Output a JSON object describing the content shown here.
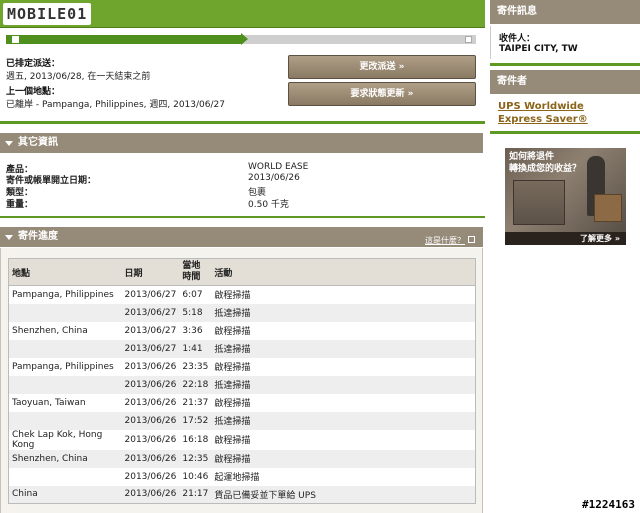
{
  "brand": {
    "logo_text": "MOBILE01"
  },
  "progress": {
    "fraction": 0.5
  },
  "shipment": {
    "scheduled_label": "已排定派送：",
    "scheduled_value": "週五, 2013/06/28, 在一天結束之前",
    "last_location_label": "上一個地點：",
    "last_location_value": "已離岸 - Pampanga, Philippines, 週四, 2013/06/27"
  },
  "buttons": {
    "change_delivery": "更改派送 »",
    "request_update": "要求狀態更新 »"
  },
  "other_info": {
    "title": "其它資訊",
    "rows": [
      {
        "key": "產品：",
        "value": "WORLD EASE"
      },
      {
        "key": "寄件或帳單開立日期：",
        "value": "2013/06/26"
      },
      {
        "key": "類型：",
        "value": "包裹"
      },
      {
        "key": "重量：",
        "value": "0.50 千克"
      }
    ]
  },
  "tracking": {
    "title": "寄件進度",
    "help_link": "這是什麼？",
    "headers": {
      "location": "地點",
      "date": "日期",
      "time": "當地\n時間",
      "activity": "活動"
    },
    "rows": [
      {
        "location": "Pampanga, Philippines",
        "date": "2013/06/27",
        "time": "6:07",
        "activity": "啟程掃描"
      },
      {
        "location": "",
        "date": "2013/06/27",
        "time": "5:18",
        "activity": "抵達掃描"
      },
      {
        "location": "Shenzhen, China",
        "date": "2013/06/27",
        "time": "3:36",
        "activity": "啟程掃描"
      },
      {
        "location": "",
        "date": "2013/06/27",
        "time": "1:41",
        "activity": "抵達掃描"
      },
      {
        "location": "Pampanga, Philippines",
        "date": "2013/06/26",
        "time": "23:35",
        "activity": "啟程掃描"
      },
      {
        "location": "",
        "date": "2013/06/26",
        "time": "22:18",
        "activity": "抵達掃描"
      },
      {
        "location": "Taoyuan, Taiwan",
        "date": "2013/06/26",
        "time": "21:37",
        "activity": "啟程掃描"
      },
      {
        "location": "",
        "date": "2013/06/26",
        "time": "17:52",
        "activity": "抵達掃描"
      },
      {
        "location": "Chek Lap Kok, Hong Kong",
        "date": "2013/06/26",
        "time": "16:18",
        "activity": "啟程掃描"
      },
      {
        "location": "Shenzhen, China",
        "date": "2013/06/26",
        "time": "12:35",
        "activity": "啟程掃描"
      },
      {
        "location": "",
        "date": "2013/06/26",
        "time": "10:46",
        "activity": "起運地掃描"
      },
      {
        "location": "China",
        "date": "2013/06/26",
        "time": "21:17",
        "activity": "貨品已備妥並下單給 UPS"
      }
    ]
  },
  "sidebar": {
    "shipment_info_title": "寄件訊息",
    "recipient_label": "收件人：",
    "recipient_value": "TAIPEI CITY, TW",
    "sender_title": "寄件者",
    "service_link_line1": "UPS Worldwide",
    "service_link_line2": "Express Saver®"
  },
  "ad": {
    "line1": "如何將退件",
    "line2": "轉換成您的收益？",
    "more": "了解更多 »"
  },
  "watermark": "#1224163"
}
